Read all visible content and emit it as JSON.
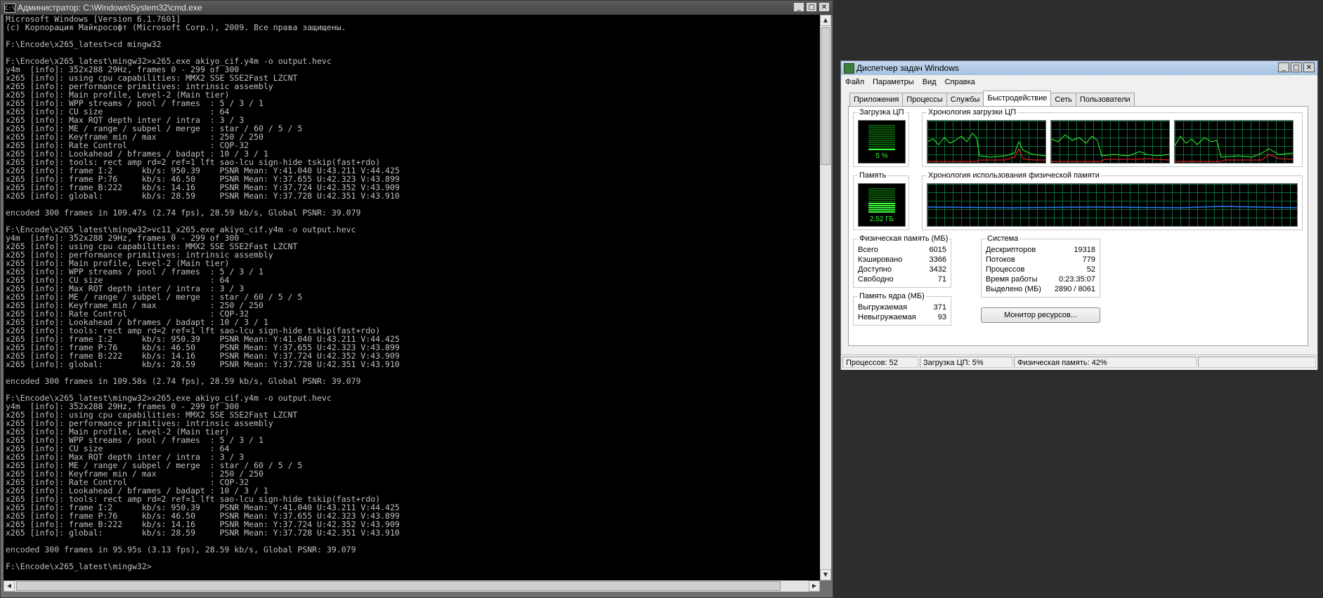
{
  "cmd": {
    "title": "Администратор: C:\\Windows\\System32\\cmd.exe",
    "icon_text": "C:\\",
    "buttons": {
      "minimize": "_",
      "maximize": "□",
      "close": "✕"
    },
    "output": "Microsoft Windows [Version 6.1.7601]\n(c) Корпорация Майкрософт (Microsoft Corp.), 2009. Все права защищены.\n\nF:\\Encode\\x265_latest>cd mingw32\n\nF:\\Encode\\x265_latest\\mingw32>x265.exe akiyo_cif.y4m -o output.hevc\ny4m  [info]: 352x288 29Hz, frames 0 - 299 of 300\nx265 [info]: using cpu capabilities: MMX2 SSE SSE2Fast LZCNT\nx265 [info]: performance primitives: intrinsic assembly\nx265 [info]: Main profile, Level-2 (Main tier)\nx265 [info]: WPP streams / pool / frames  : 5 / 3 / 1\nx265 [info]: CU size                      : 64\nx265 [info]: Max RQT depth inter / intra  : 3 / 3\nx265 [info]: ME / range / subpel / merge  : star / 60 / 5 / 5\nx265 [info]: Keyframe min / max           : 250 / 250\nx265 [info]: Rate Control                 : CQP-32\nx265 [info]: Lookahead / bframes / badapt : 10 / 3 / 1\nx265 [info]: tools: rect amp rd=2 ref=1 lft sao-lcu sign-hide tskip(fast+rdo)\nx265 [info]: frame I:2      kb/s: 950.39    PSNR Mean: Y:41.040 U:43.211 V:44.425\nx265 [info]: frame P:76     kb/s: 46.50     PSNR Mean: Y:37.655 U:42.323 V:43.899\nx265 [info]: frame B:222    kb/s: 14.16     PSNR Mean: Y:37.724 U:42.352 V:43.909\nx265 [info]: global:        kb/s: 28.59     PSNR Mean: Y:37.728 U:42.351 V:43.910\n\nencoded 300 frames in 109.47s (2.74 fps), 28.59 kb/s, Global PSNR: 39.079\n\nF:\\Encode\\x265_latest\\mingw32>vc11_x265.exe akiyo_cif.y4m -o output.hevc\ny4m  [info]: 352x288 29Hz, frames 0 - 299 of 300\nx265 [info]: using cpu capabilities: MMX2 SSE SSE2Fast LZCNT\nx265 [info]: performance primitives: intrinsic assembly\nx265 [info]: Main profile, Level-2 (Main tier)\nx265 [info]: WPP streams / pool / frames  : 5 / 3 / 1\nx265 [info]: CU size                      : 64\nx265 [info]: Max RQT depth inter / intra  : 3 / 3\nx265 [info]: ME / range / subpel / merge  : star / 60 / 5 / 5\nx265 [info]: Keyframe min / max           : 250 / 250\nx265 [info]: Rate Control                 : CQP-32\nx265 [info]: Lookahead / bframes / badapt : 10 / 3 / 1\nx265 [info]: tools: rect amp rd=2 ref=1 lft sao-lcu sign-hide tskip(fast+rdo)\nx265 [info]: frame I:2      kb/s: 950.39    PSNR Mean: Y:41.040 U:43.211 V:44.425\nx265 [info]: frame P:76     kb/s: 46.50     PSNR Mean: Y:37.655 U:42.323 V:43.899\nx265 [info]: frame B:222    kb/s: 14.16     PSNR Mean: Y:37.724 U:42.352 V:43.909\nx265 [info]: global:        kb/s: 28.59     PSNR Mean: Y:37.728 U:42.351 V:43.910\n\nencoded 300 frames in 109.58s (2.74 fps), 28.59 kb/s, Global PSNR: 39.079\n\nF:\\Encode\\x265_latest\\mingw32>x265.exe akiyo_cif.y4m -o output.hevc\ny4m  [info]: 352x288 29Hz, frames 0 - 299 of 300\nx265 [info]: using cpu capabilities: MMX2 SSE SSE2Fast LZCNT\nx265 [info]: performance primitives: intrinsic assembly\nx265 [info]: Main profile, Level-2 (Main tier)\nx265 [info]: WPP streams / pool / frames  : 5 / 3 / 1\nx265 [info]: CU size                      : 64\nx265 [info]: Max RQT depth inter / intra  : 3 / 3\nx265 [info]: ME / range / subpel / merge  : star / 60 / 5 / 5\nx265 [info]: Keyframe min / max           : 250 / 250\nx265 [info]: Rate Control                 : CQP-32\nx265 [info]: Lookahead / bframes / badapt : 10 / 3 / 1\nx265 [info]: tools: rect amp rd=2 ref=1 lft sao-lcu sign-hide tskip(fast+rdo)\nx265 [info]: frame I:2      kb/s: 950.39    PSNR Mean: Y:41.040 U:43.211 V:44.425\nx265 [info]: frame P:76     kb/s: 46.50     PSNR Mean: Y:37.655 U:42.323 V:43.899\nx265 [info]: frame B:222    kb/s: 14.16     PSNR Mean: Y:37.724 U:42.352 V:43.909\nx265 [info]: global:        kb/s: 28.59     PSNR Mean: Y:37.728 U:42.351 V:43.910\n\nencoded 300 frames in 95.95s (3.13 fps), 28.59 kb/s, Global PSNR: 39.079\n\nF:\\Encode\\x265_latest\\mingw32>"
  },
  "taskmgr": {
    "title": "Диспетчер задач Windows",
    "buttons": {
      "minimize": "_",
      "maximize": "□",
      "close": "✕"
    },
    "menu": [
      "Файл",
      "Параметры",
      "Вид",
      "Справка"
    ],
    "tabs": [
      "Приложения",
      "Процессы",
      "Службы",
      "Быстродействие",
      "Сеть",
      "Пользователи"
    ],
    "active_tab": "Быстродействие",
    "cpu": {
      "label": "Загрузка ЦП",
      "value_text": "5 %",
      "level": 0.05
    },
    "cpu_history": {
      "label": "Хронология загрузки ЦП"
    },
    "memory": {
      "label": "Память",
      "value_text": "2,52 ГБ",
      "level": 0.42
    },
    "memory_history": {
      "label": "Хронология использования физической памяти"
    },
    "physical": {
      "label": "Физическая память (МБ)",
      "rows": [
        {
          "k": "Всего",
          "v": "6015"
        },
        {
          "k": "Кэшировано",
          "v": "3366"
        },
        {
          "k": "Доступно",
          "v": "3432"
        },
        {
          "k": "Свободно",
          "v": "71"
        }
      ]
    },
    "kernel": {
      "label": "Память ядра (МБ)",
      "rows": [
        {
          "k": "Выгружаемая",
          "v": "371"
        },
        {
          "k": "Невыгружаемая",
          "v": "93"
        }
      ]
    },
    "system": {
      "label": "Система",
      "rows": [
        {
          "k": "Дескрипторов",
          "v": "19318"
        },
        {
          "k": "Потоков",
          "v": "779"
        },
        {
          "k": "Процессов",
          "v": "52"
        },
        {
          "k": "Время работы",
          "v": "0:23:35:07"
        },
        {
          "k": "Выделено (МБ)",
          "v": "2890 / 8061"
        }
      ]
    },
    "resource_monitor_button": "Монитор ресурсов...",
    "status": {
      "processes": "Процессов: 52",
      "cpu": "Загрузка ЦП: 5%",
      "memory": "Физическая память: 42%"
    },
    "colors": {
      "graph_green": "#2bff2b",
      "graph_red": "#ff2020",
      "memory_line": "#2e7cff"
    }
  }
}
